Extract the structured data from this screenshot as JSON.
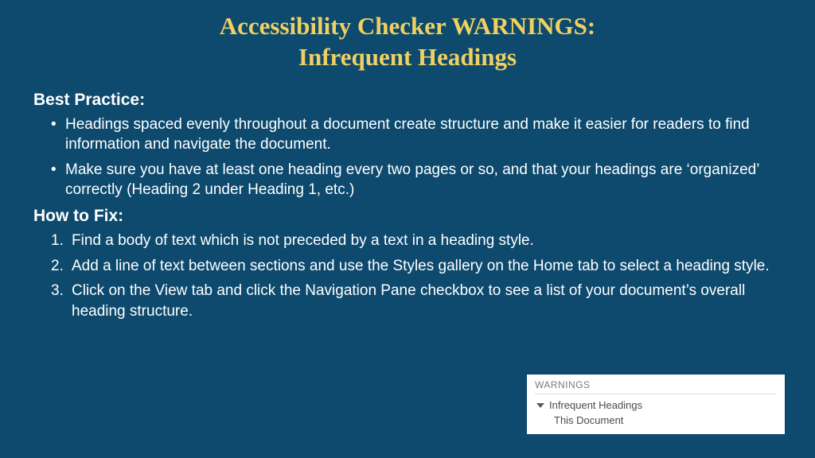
{
  "title_line1": "Accessibility Checker WARNINGS:",
  "title_line2": "Infrequent Headings",
  "sections": {
    "best_practice": {
      "label": "Best Practice:",
      "items": [
        "Headings spaced evenly throughout a document create structure and make it easier for readers to find information and navigate the document.",
        "Make sure you have at least one heading every two pages or so, and that your headings are ‘organized’ correctly (Heading 2 under Heading 1, etc.)"
      ]
    },
    "how_to_fix": {
      "label": "How to Fix:",
      "steps": [
        "Find a body of text which is not preceded by a text in a heading style.",
        "Add a line of text between sections and use the Styles gallery on the Home tab to select a heading style.",
        "Click on the View tab and click the Navigation Pane checkbox to see a list of your document’s overall heading structure."
      ]
    }
  },
  "warnings_pane": {
    "header": "WARNINGS",
    "item": "Infrequent Headings",
    "child": "This Document"
  }
}
